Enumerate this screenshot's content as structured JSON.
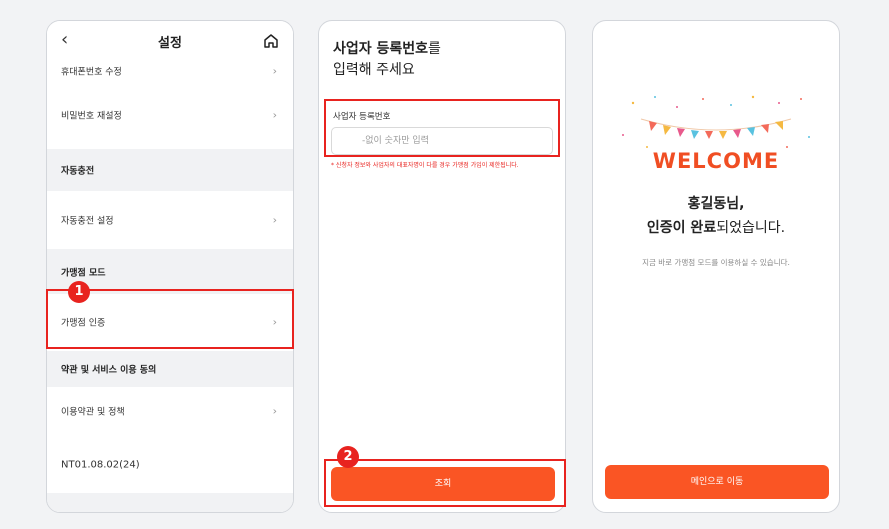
{
  "screen1": {
    "title": "설정",
    "back_icon": "‹",
    "rows": [
      {
        "label": "휴대폰번호 수정"
      },
      {
        "label": "비밀번호 재설정"
      },
      {
        "label": "자동충전"
      },
      {
        "label": "자동충전 설정"
      },
      {
        "label": "가맹점 모드"
      },
      {
        "label": "가맹점 인증"
      },
      {
        "label": "약관 및 서비스 이용 동의"
      },
      {
        "label": "이용약관 및 정책"
      },
      {
        "label": "NT01.08.02(24)"
      }
    ],
    "chevron": "›",
    "badge": "1"
  },
  "screen2": {
    "title_bold": "사업자 등록번호",
    "title_rest": "를",
    "title_line2": "입력해 주세요",
    "field_label": "사업자 등록번호",
    "placeholder": "-없이 숫자만 입력",
    "notice": "* 신청자 정보와 사업자의 대표자명이 다를 경우 가맹점 가입이 제한됩니다.",
    "button": "조회",
    "badge": "2"
  },
  "screen3": {
    "welcome": "WELCOME",
    "line1": "홍길동님,",
    "line2_bold": "인증이 완료",
    "line2_rest": "되었습니다.",
    "sub": "지금 바로 가맹점 모드를 이용하실 수 있습니다.",
    "button": "메인으로 이동"
  },
  "colors": {
    "accent": "#fa5524",
    "highlight": "#e8231f",
    "section_bg": "#f1f2f4"
  }
}
